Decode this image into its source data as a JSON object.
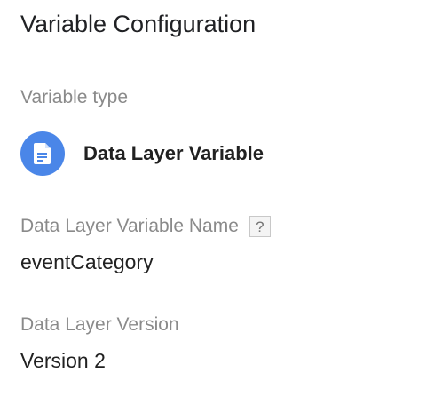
{
  "panel": {
    "title": "Variable Configuration",
    "variable_type": {
      "label": "Variable type",
      "name": "Data Layer Variable",
      "icon": "document-icon",
      "icon_color": "#4a86e8"
    },
    "data_layer_variable_name": {
      "label": "Data Layer Variable Name",
      "help": "?",
      "value": "eventCategory"
    },
    "data_layer_version": {
      "label": "Data Layer Version",
      "value": "Version 2"
    }
  }
}
